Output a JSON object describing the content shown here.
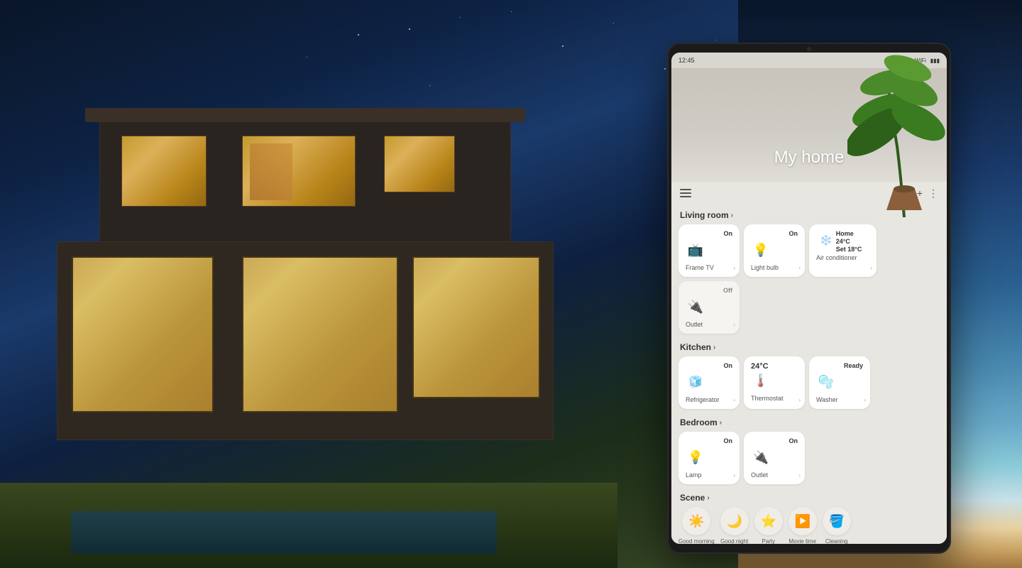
{
  "background": {
    "description": "Modern house at night with pool"
  },
  "status_bar": {
    "time": "12:45",
    "signal": "●●●",
    "battery": "▮▮▮"
  },
  "header": {
    "home_title": "My home"
  },
  "toolbar": {
    "menu_icon": "☰",
    "add_icon": "+",
    "more_icon": "⋮"
  },
  "sections": [
    {
      "id": "living_room",
      "label": "Living room",
      "devices": [
        {
          "id": "frame_tv",
          "name": "Frame TV",
          "status": "On",
          "active": true,
          "icon": "📺"
        },
        {
          "id": "light_bulb",
          "name": "Light bulb",
          "status": "On",
          "active": true,
          "icon": "💡"
        },
        {
          "id": "air_conditioner",
          "name": "Air conditioner",
          "status": "",
          "active": true,
          "icon": "❄️",
          "temp_home": "Home 24°C",
          "temp_set": "Set 18°C"
        },
        {
          "id": "outlet_lr",
          "name": "Outlet",
          "status": "Off",
          "active": false,
          "icon": "🔌"
        }
      ]
    },
    {
      "id": "kitchen",
      "label": "Kitchen",
      "devices": [
        {
          "id": "refrigerator",
          "name": "Refrigerator",
          "status": "On",
          "active": true,
          "icon": "🧊"
        },
        {
          "id": "thermostat",
          "name": "Thermostat",
          "status": "24°C",
          "active": true,
          "icon": "🌡️"
        },
        {
          "id": "washer",
          "name": "Washer",
          "status": "Ready",
          "active": true,
          "icon": "🫧"
        }
      ]
    },
    {
      "id": "bedroom",
      "label": "Bedroom",
      "devices": [
        {
          "id": "lamp",
          "name": "Lamp",
          "status": "On",
          "active": true,
          "icon": "💡"
        },
        {
          "id": "outlet_bed",
          "name": "Outlet",
          "status": "On",
          "active": true,
          "icon": "🔌"
        }
      ]
    },
    {
      "id": "scene",
      "label": "Scene",
      "scenes": [
        {
          "id": "good_morning",
          "label": "Good morning",
          "icon": "☀️"
        },
        {
          "id": "good_night",
          "label": "Good night",
          "icon": "🌙"
        },
        {
          "id": "party",
          "label": "Party",
          "icon": "⭐"
        },
        {
          "id": "movie_time",
          "label": "Movie time",
          "icon": "▶️"
        },
        {
          "id": "cleaning",
          "label": "Cleaning",
          "icon": "🪣"
        }
      ]
    }
  ]
}
